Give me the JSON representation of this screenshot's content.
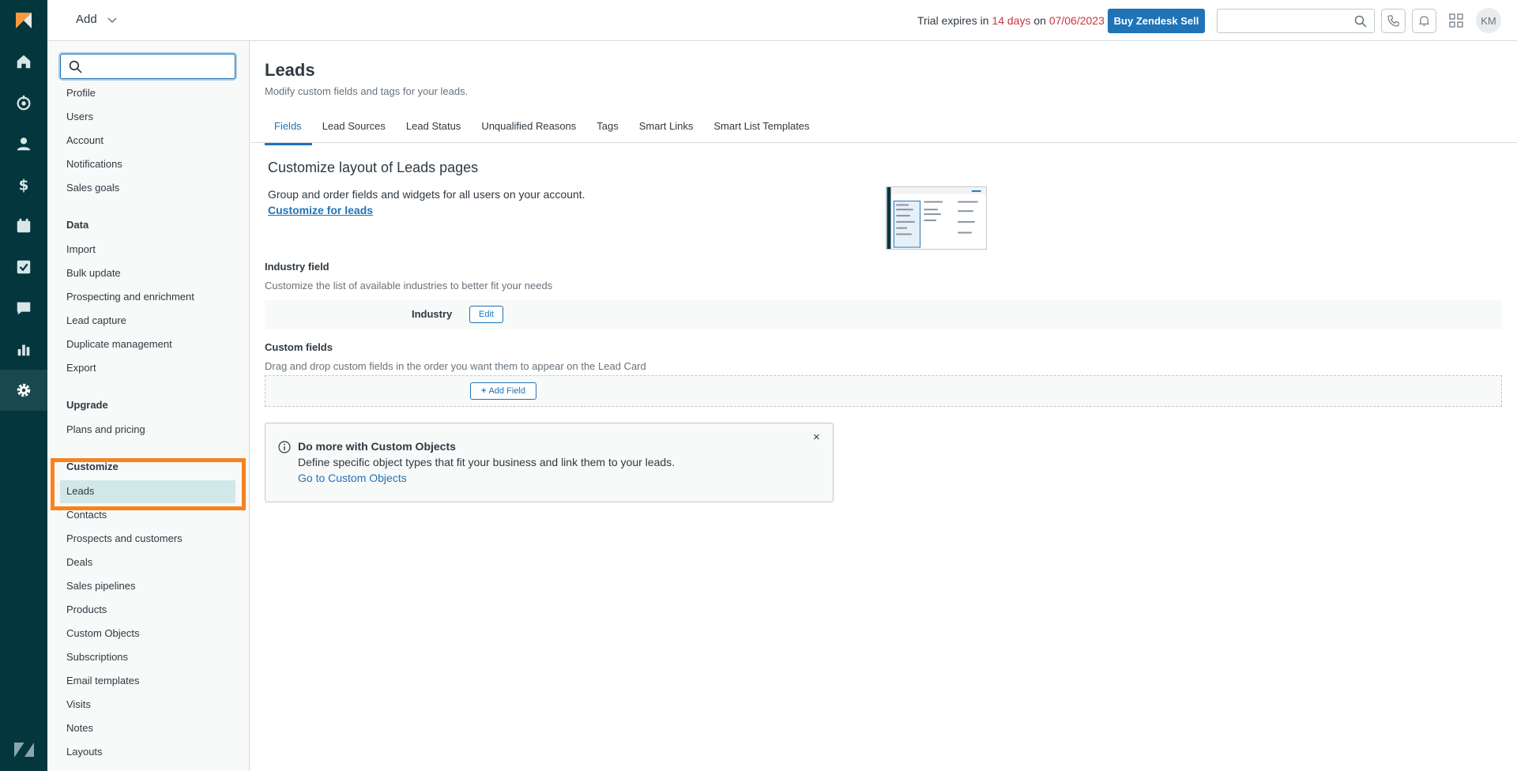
{
  "topbar": {
    "add_label": "Add",
    "trial": {
      "prefix": "Trial expires in ",
      "days": "14 days",
      "middle": " on ",
      "date": "07/06/2023"
    },
    "buy_label": "Buy Zendesk Sell",
    "search_placeholder": "",
    "avatar_initials": "KM"
  },
  "sidebar": {
    "search_placeholder": "",
    "items_top": [
      "Profile",
      "Users",
      "Account",
      "Notifications",
      "Sales goals"
    ],
    "data_heading": "Data",
    "data_items": [
      "Import",
      "Bulk update",
      "Prospecting and enrichment",
      "Lead capture",
      "Duplicate management",
      "Export"
    ],
    "upgrade_heading": "Upgrade",
    "upgrade_items": [
      "Plans and pricing"
    ],
    "customize_heading": "Customize",
    "customize_items": [
      "Leads",
      "Contacts",
      "Prospects and customers",
      "Deals",
      "Sales pipelines",
      "Products",
      "Custom Objects",
      "Subscriptions",
      "Email templates",
      "Visits",
      "Notes",
      "Layouts"
    ]
  },
  "main": {
    "title": "Leads",
    "subtitle": "Modify custom fields and tags for your leads.",
    "tabs": [
      "Fields",
      "Lead Sources",
      "Lead Status",
      "Unqualified Reasons",
      "Tags",
      "Smart Links",
      "Smart List Templates"
    ],
    "customize": {
      "title": "Customize layout of Leads pages",
      "text": "Group and order fields and widgets for all users on your account.",
      "link": "Customize for leads"
    },
    "industry": {
      "title": "Industry field",
      "subtitle": "Customize the list of available industries to better fit your needs",
      "label": "Industry",
      "edit": "Edit"
    },
    "custom_fields": {
      "title": "Custom fields",
      "subtitle": "Drag and drop custom fields in the order you want them to appear on the Lead Card",
      "add_field": "Add Field"
    },
    "notice": {
      "title": "Do more with Custom Objects",
      "text": "Define specific object types that fit your business and link them to your leads.",
      "link": "Go to Custom Objects",
      "close": "×"
    }
  },
  "colors": {
    "rail": "#03363d",
    "accent": "#1f73b7",
    "highlight": "#f7821e",
    "alert": "#cc3340"
  }
}
